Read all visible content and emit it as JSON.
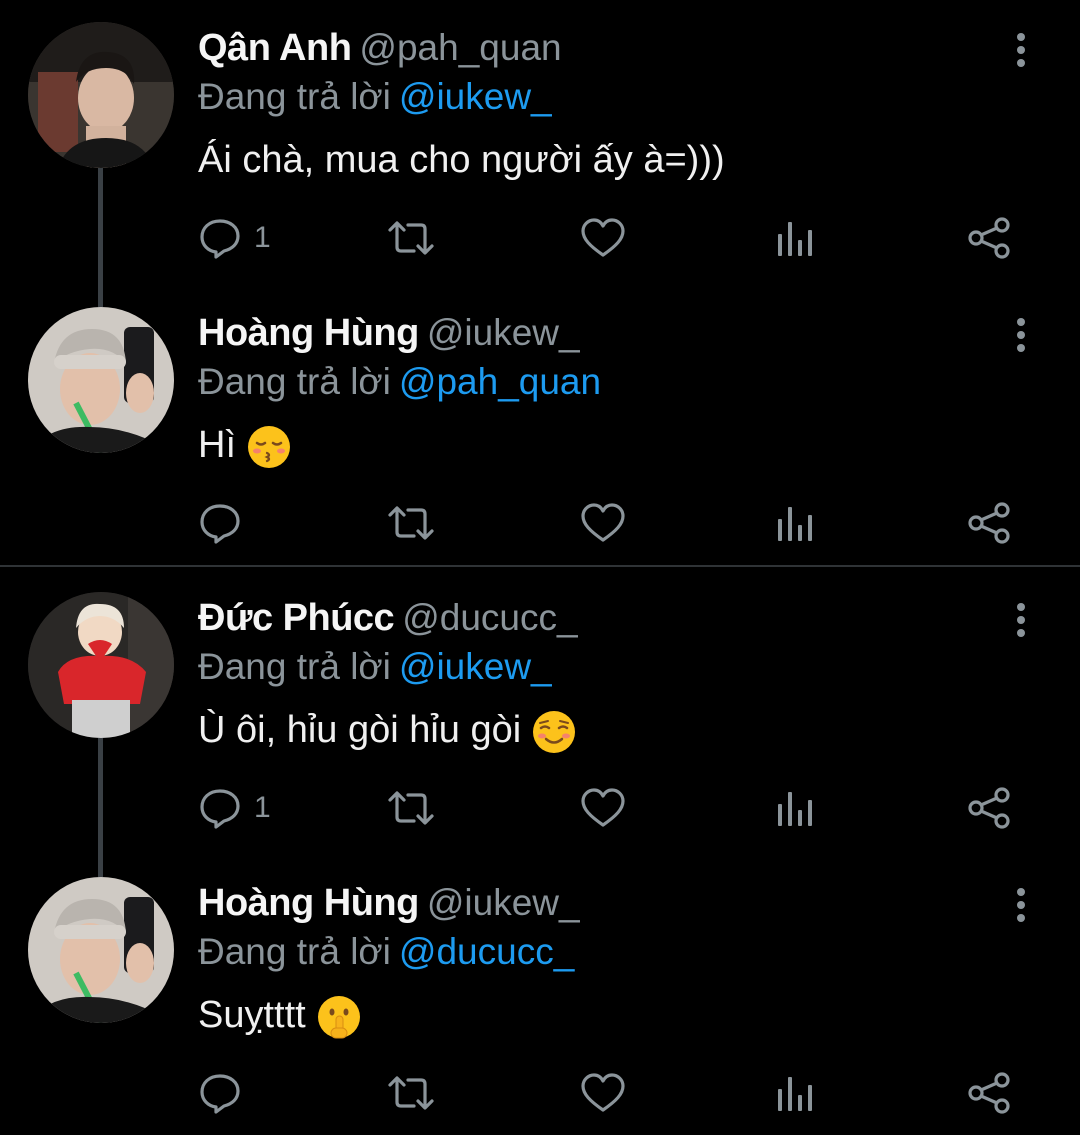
{
  "tweets": [
    {
      "name": "Qân Anh",
      "handle": "@pah_quan",
      "reply_prefix": "Đang trả lời",
      "reply_to": "@iukew_",
      "text": "Ái chà, mua cho người ấy à=)))",
      "emoji": "",
      "reply_count": "1"
    },
    {
      "name": "Hoàng Hùng",
      "handle": "@iukew_",
      "reply_prefix": "Đang trả lời",
      "reply_to": "@pah_quan",
      "text": "Hì",
      "emoji": "kissing-face-with-closed-eyes",
      "reply_count": ""
    },
    {
      "name": "Đức Phúcc",
      "handle": "@ducucc_",
      "reply_prefix": "Đang trả lời",
      "reply_to": "@iukew_",
      "text": "Ù ôi, hỉu gòi hỉu gòi",
      "emoji": "smiling-face",
      "reply_count": "1"
    },
    {
      "name": "Hoàng Hùng",
      "handle": "@iukew_",
      "reply_prefix": "Đang trả lời",
      "reply_to": "@ducucc_",
      "text": "Suỵtttt",
      "emoji": "shushing-face",
      "reply_count": ""
    }
  ],
  "colors": {
    "background": "#000000",
    "mention": "#1d9bf0",
    "secondary_text": "#8b949a",
    "primary_text": "#f0f0f0",
    "thread_line": "#3a4045",
    "divider": "#2f3336"
  },
  "icons": {
    "reply": "comment-bubble-icon",
    "retweet": "retweet-icon",
    "like": "heart-icon",
    "views": "bar-chart-icon",
    "share": "share-icon",
    "more": "more-vertical-icon"
  }
}
